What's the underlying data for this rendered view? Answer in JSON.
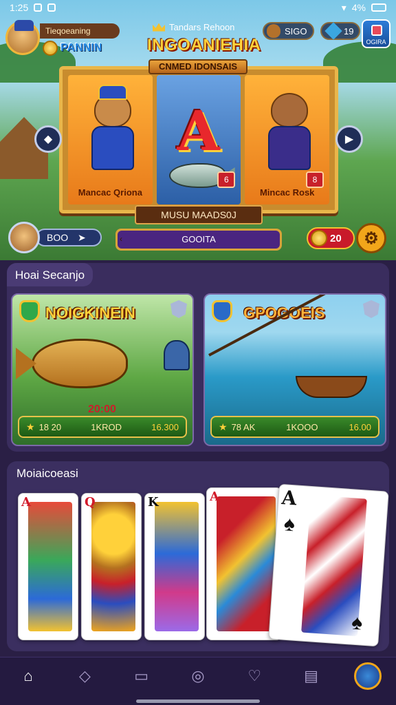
{
  "status_bar": {
    "time": "1:25",
    "battery": "4%"
  },
  "header": {
    "player_name": "Tieqoeaning",
    "player_level": "PANNIN",
    "center_label": "Tandars Rehoon",
    "currency_1": "SIGO",
    "currency_2": "19",
    "bonus_label": "OGIRA"
  },
  "hero": {
    "title": "INGOANIEHIA",
    "subtitle": "CNMED IDONSAIS",
    "reel_left_label": "Mancac Qriona",
    "reel_right_label": "Mincac Rosk",
    "reel_center_symbol": "A",
    "reel_center_badge": "6",
    "reel_right_badge": "8",
    "spin_label": "MUSU MAADS0J",
    "player2_label": "BOO",
    "progress_label": "GOOITA",
    "reward_value": "20",
    "progress_percent": 100
  },
  "section1": {
    "title": "Hoai Secanjo",
    "cards": [
      {
        "title": "NOIGKINEIN",
        "amount": "20:00",
        "bar": [
          "18 20",
          "1KROD",
          "16.300"
        ]
      },
      {
        "title": "GPOGOEIS",
        "amount": "",
        "bar": [
          "78 AK",
          "1KOOO",
          "16.00"
        ]
      }
    ]
  },
  "section2": {
    "title": "Moiaicoeasi",
    "cards": [
      {
        "rank": "A",
        "color": "red"
      },
      {
        "rank": "Q",
        "color": "red"
      },
      {
        "rank": "K",
        "color": "black"
      },
      {
        "rank": "A",
        "color": "red"
      },
      {
        "rank": "A",
        "color": "black"
      }
    ]
  },
  "nav": {
    "items": [
      "home-icon",
      "bag-icon",
      "bookmark-icon",
      "chat-icon",
      "shield-icon",
      "wallet-icon",
      "profile-avatar"
    ]
  },
  "colors": {
    "background": "#2a1f45",
    "section": "#3a2d5e",
    "accent_gold": "#ffd13a",
    "accent_red": "#c8202a",
    "progress_fill": "#4a2580"
  }
}
